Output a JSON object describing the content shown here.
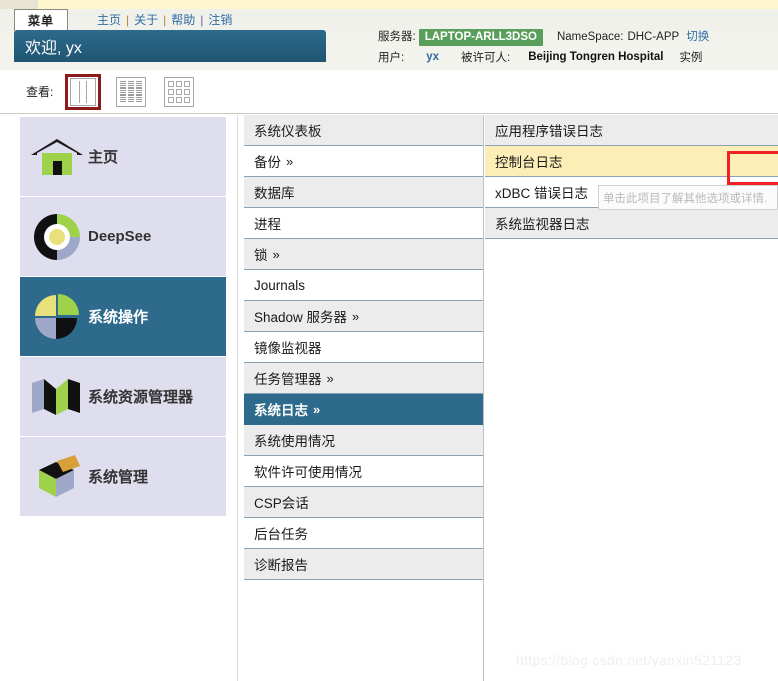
{
  "header": {
    "menu_tab_label": "菜单",
    "nav_links": [
      {
        "label": "主页"
      },
      {
        "label": "关于"
      },
      {
        "label": "帮助"
      },
      {
        "label": "注销"
      }
    ],
    "nav_separator": "|",
    "welcome_text": "欢迎, yx",
    "server_label": "服务器:",
    "server_name": "LAPTOP-ARLL3DSO",
    "namespace_label": "NameSpace:",
    "namespace_value": "DHC-APP",
    "switch_link": "切换",
    "user_label": "用户:",
    "user_value": "yx",
    "licensed_to_label": "被许可人:",
    "licensed_to_value": "Beijing Tongren Hospital",
    "instance_label": "实例"
  },
  "viewbar": {
    "label": "查看:",
    "icons": [
      {
        "name": "columns-view-icon",
        "selected": true
      },
      {
        "name": "list-view-icon",
        "selected": false
      },
      {
        "name": "grid-view-icon",
        "selected": false
      }
    ]
  },
  "sidebar": {
    "items": [
      {
        "label": "主页",
        "icon": "home-icon",
        "active": false
      },
      {
        "label": "DeepSee",
        "icon": "donut-chart-icon",
        "active": false
      },
      {
        "label": "系统操作",
        "icon": "pie-chart-icon",
        "active": true
      },
      {
        "label": "系统资源管理器",
        "icon": "folded-ribbon-icon",
        "active": false
      },
      {
        "label": "系统管理",
        "icon": "cube-box-icon",
        "active": false
      }
    ]
  },
  "middle_column": {
    "items": [
      {
        "label": "系统仪表板",
        "chevron": "",
        "style": "alt"
      },
      {
        "label": "备份",
        "chevron": "»",
        "style": "plain"
      },
      {
        "label": "数据库",
        "chevron": "",
        "style": "alt"
      },
      {
        "label": "进程",
        "chevron": "",
        "style": "plain"
      },
      {
        "label": "锁",
        "chevron": "»",
        "style": "alt"
      },
      {
        "label": "Journals",
        "chevron": "",
        "style": "plain"
      },
      {
        "label": "Shadow 服务器",
        "chevron": "»",
        "style": "alt"
      },
      {
        "label": "镜像监视器",
        "chevron": "",
        "style": "plain"
      },
      {
        "label": "任务管理器",
        "chevron": "»",
        "style": "alt"
      },
      {
        "label": "系统日志",
        "chevron": "»",
        "style": "sel"
      },
      {
        "label": "系统使用情况",
        "chevron": "",
        "style": "alt"
      },
      {
        "label": "软件许可使用情况",
        "chevron": "",
        "style": "plain"
      },
      {
        "label": "CSP会话",
        "chevron": "",
        "style": "alt"
      },
      {
        "label": "后台任务",
        "chevron": "",
        "style": "plain"
      },
      {
        "label": "诊断报告",
        "chevron": "",
        "style": "alt"
      }
    ]
  },
  "right_column": {
    "items": [
      {
        "label": "应用程序错误日志",
        "style": "alt"
      },
      {
        "label": "控制台日志",
        "style": "hl"
      },
      {
        "label": "xDBC 错误日志",
        "style": "plain"
      },
      {
        "label": "系统监视器日志",
        "style": "alt"
      }
    ],
    "tooltip_text": "单击此项目了解其他选项或详情."
  },
  "watermark": "https://blog.csdn.net/yaoxin521123",
  "colors": {
    "accent": "#2d6a8c",
    "sidebar_bg": "#dedeee",
    "server_badge": "#5a9e5c",
    "highlight_yellow": "#fdeeb8",
    "annotation_red": "#ee2222",
    "link_blue": "#2e6da4"
  }
}
